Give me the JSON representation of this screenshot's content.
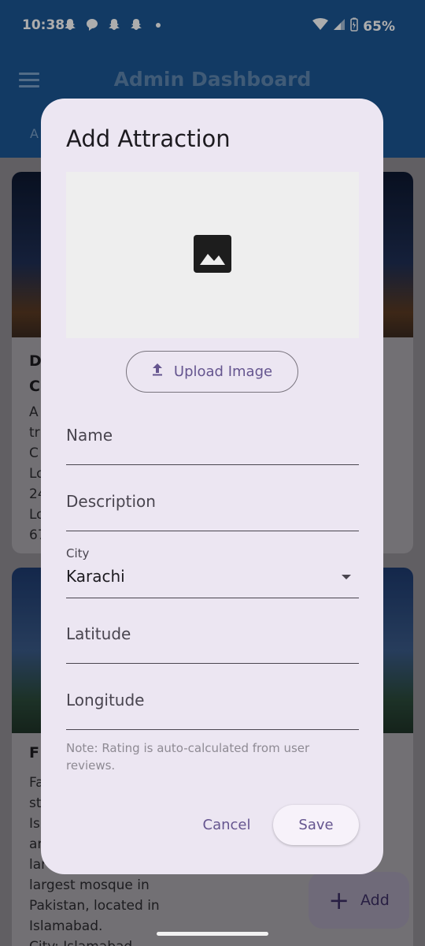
{
  "status_bar": {
    "time": "10:38",
    "battery": "65%"
  },
  "app_bar": {
    "title": "Admin Dashboard",
    "tab_peek": "A"
  },
  "background_cards": [
    {
      "title": "D\nC",
      "text": "A\ntr\nC\nLo\n24\nLo\n67"
    },
    {
      "title": "F",
      "text": "Fa\nst\nIs\nar\nlar\nlargest mosque in\nPakistan, located in\nIslamabad.\nCity: Islamabad"
    }
  ],
  "fab": {
    "label": "Add"
  },
  "dialog": {
    "title": "Add Attraction",
    "upload_button": "Upload Image",
    "fields": {
      "name": {
        "label": "Name",
        "value": ""
      },
      "description": {
        "label": "Description",
        "value": ""
      },
      "city": {
        "label": "City",
        "value": "Karachi"
      },
      "latitude": {
        "label": "Latitude",
        "value": ""
      },
      "longitude": {
        "label": "Longitude",
        "value": ""
      }
    },
    "note": "Note: Rating is auto-calculated from user reviews.",
    "cancel_button": "Cancel",
    "save_button": "Save"
  },
  "colors": {
    "app_bar": "#1b5694",
    "dialog_bg": "#ece6f2",
    "accent": "#65558f",
    "scrim": "rgba(0,0,0,0.32)"
  },
  "icons": {
    "image_placeholder": "image-icon",
    "upload": "upload-icon",
    "menu": "menu-icon",
    "fab": "plus-icon",
    "dropdown": "caret-down-icon"
  }
}
